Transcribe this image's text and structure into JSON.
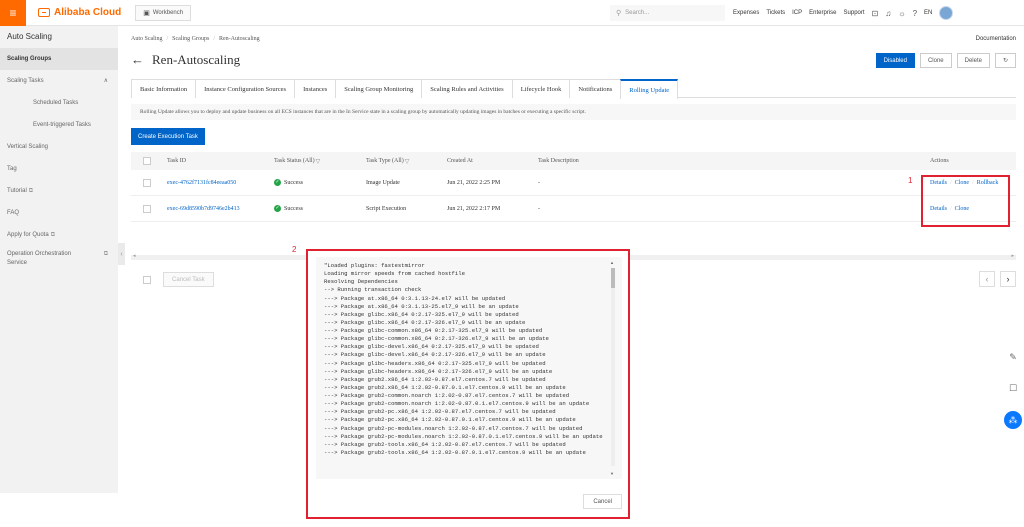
{
  "topbar": {
    "menu_icon": "hamburger-icon",
    "brand": "Alibaba Cloud",
    "workbench": "Workbench",
    "search_placeholder": "Search...",
    "nav": [
      "Expenses",
      "Tickets",
      "ICP",
      "Enterprise",
      "Support"
    ],
    "lang": "EN"
  },
  "sidebar": {
    "title": "Auto Scaling",
    "items": [
      {
        "label": "Scaling Groups"
      },
      {
        "label": "Scaling Tasks"
      },
      {
        "label": "Scheduled Tasks"
      },
      {
        "label": "Event-triggered Tasks"
      },
      {
        "label": "Vertical Scaling"
      },
      {
        "label": "Tag"
      },
      {
        "label": "Tutorial"
      },
      {
        "label": "FAQ"
      },
      {
        "label": "Apply for Quota"
      },
      {
        "label": "Operation Orchestration Service"
      }
    ]
  },
  "breadcrumb": [
    "Auto Scaling",
    "Scaling Groups",
    "Ren-Autoscaling"
  ],
  "documentation": "Documentation",
  "page_title": "Ren-Autoscaling",
  "header_buttons": {
    "disabled": "Disabled",
    "clone": "Clone",
    "delete": "Delete"
  },
  "tabs": [
    "Basic Information",
    "Instance Configuration Sources",
    "Instances",
    "Scaling Group Monitoring",
    "Scaling Rules and Activities",
    "Lifecycle Hook",
    "Notifications",
    "Rolling Update"
  ],
  "info_text": "Rolling Update allows you to deploy and update business on all ECS instances that are in the In Service state in a scaling group by automatically updating images in batches or executing a specific script.",
  "create_button": "Create Execution Task",
  "table": {
    "headers": {
      "task_id": "Task ID",
      "status": "Task Status (All)",
      "type": "Task Type (All)",
      "created": "Created At",
      "desc": "Task Description",
      "actions": "Actions"
    },
    "rows": [
      {
        "id": "exec-4762f7131fc84eeaa050",
        "status": "Success",
        "type": "Image Update",
        "created": "Jun 21, 2022 2:25 PM",
        "desc": "-",
        "actions": [
          "Details",
          "Clone",
          "Rollback"
        ]
      },
      {
        "id": "exec-69d8590b7d9746e2b413",
        "status": "Success",
        "type": "Script Execution",
        "created": "Jun 21, 2022 2:17 PM",
        "desc": "-",
        "actions": [
          "Details",
          "Clone"
        ]
      }
    ]
  },
  "cancel_task": "Cancel Task",
  "annotations": {
    "box1": "1",
    "box2": "2"
  },
  "log": {
    "lines": [
      "\"Loaded plugins: fastestmirror",
      "Loading mirror speeds from cached hostfile",
      "Resolving Dependencies",
      "--> Running transaction check",
      "---> Package at.x86_64 0:3.1.13-24.el7 will be updated",
      "---> Package at.x86_64 0:3.1.13-25.el7_9 will be an update",
      "---> Package glibc.x86_64 0:2.17-325.el7_9 will be updated",
      "---> Package glibc.x86_64 0:2.17-326.el7_9 will be an update",
      "---> Package glibc-common.x86_64 0:2.17-325.el7_9 will be updated",
      "---> Package glibc-common.x86_64 0:2.17-326.el7_9 will be an update",
      "---> Package glibc-devel.x86_64 0:2.17-325.el7_9 will be updated",
      "---> Package glibc-devel.x86_64 0:2.17-326.el7_9 will be an update",
      "---> Package glibc-headers.x86_64 0:2.17-325.el7_9 will be updated",
      "---> Package glibc-headers.x86_64 0:2.17-326.el7_9 will be an update",
      "---> Package grub2.x86_64 1:2.02-0.87.el7.centos.7 will be updated",
      "---> Package grub2.x86_64 1:2.02-0.87.0.1.el7.centos.9 will be an update",
      "---> Package grub2-common.noarch 1:2.02-0.87.el7.centos.7 will be updated",
      "---> Package grub2-common.noarch 1:2.02-0.87.0.1.el7.centos.9 will be an update",
      "---> Package grub2-pc.x86_64 1:2.02-0.87.el7.centos.7 will be updated",
      "---> Package grub2-pc.x86_64 1:2.02-0.87.0.1.el7.centos.9 will be an update",
      "---> Package grub2-pc-modules.noarch 1:2.02-0.87.el7.centos.7 will be updated",
      "---> Package grub2-pc-modules.noarch 1:2.02-0.87.0.1.el7.centos.9 will be an update",
      "---> Package grub2-tools.x86_64 1:2.02-0.87.el7.centos.7 will be updated",
      "---> Package grub2-tools.x86_64 1:2.02-0.87.0.1.el7.centos.9 will be an update"
    ],
    "cancel": "Cancel"
  },
  "colors": {
    "accent": "#0064c8",
    "brand": "#ff6a00",
    "annotation": "#e0212f",
    "success": "#23a446"
  }
}
